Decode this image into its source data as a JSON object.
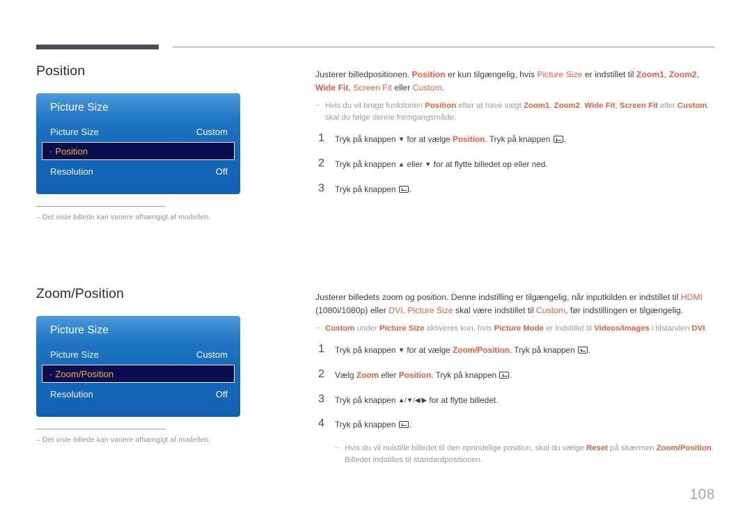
{
  "page": {
    "number": "108"
  },
  "sections": [
    {
      "id": "position",
      "title": "Position",
      "osd": {
        "title": "Picture Size",
        "rows": [
          {
            "label": "Picture Size",
            "value": "Custom",
            "selected": false
          },
          {
            "label": "Position",
            "value": "",
            "selected": true,
            "bullet": "·"
          },
          {
            "label": "Resolution",
            "value": "Off",
            "selected": false
          }
        ]
      },
      "caption": {
        "dash": "–",
        "text": "Det viste billede kan variere afhængigt af modellen."
      },
      "intro": {
        "t1": "Justerer billedpositionen. ",
        "hl1": "Position",
        "t2": " er kun tilgængelig, hvis ",
        "hl2": "Picture Size",
        "t3": " er indstillet til ",
        "hl3": "Zoom1",
        "t4": ", ",
        "hl4": "Zoom2",
        "t5": ", ",
        "hl5": "Wide Fit",
        "t6": ", ",
        "hl6": "Screen Fit",
        "t7": " eller ",
        "hl7": "Custom",
        "t8": "."
      },
      "note": {
        "dash": "–",
        "t1": "Hvis du vil bruge funktionen ",
        "hl1": "Position",
        "t2": " efter at have valgt ",
        "hl2": "Zoom1",
        "t3": ", ",
        "hl3": "Zoom2",
        "t4": ", ",
        "hl4": "Wide Fit",
        "t5": ", ",
        "hl5": "Screen Fit",
        "t6": " eller ",
        "hl6": "Custom",
        "t7": ", skal du følge denne fremgangsmåde."
      },
      "steps": [
        {
          "num": "1",
          "t1": "Tryk på knappen ",
          "arrow1": "▼",
          "t2": " for at vælge ",
          "hl1": "Position",
          "t3": ". Tryk på knappen ",
          "t4": "."
        },
        {
          "num": "2",
          "t1": "Tryk på knappen ",
          "arrow1": "▲",
          "t2": " eller ",
          "arrow2": "▼",
          "t3": " for at flytte billedet op eller ned."
        },
        {
          "num": "3",
          "t1": "Tryk på knappen ",
          "t2": "."
        }
      ]
    },
    {
      "id": "zoomposition",
      "title": "Zoom/Position",
      "osd": {
        "title": "Picture Size",
        "rows": [
          {
            "label": "Picture Size",
            "value": "Custom",
            "selected": false
          },
          {
            "label": "Zoom/Position",
            "value": "",
            "selected": true,
            "bullet": "·"
          },
          {
            "label": "Resolution",
            "value": "Off",
            "selected": false
          }
        ]
      },
      "caption": {
        "dash": "–",
        "text": "Det viste billede kan variere afhængigt af modellen."
      },
      "intro": {
        "t1": "Justerer billedets zoom og position. Denne indstilling er tilgængelig, når inputkilden er indstillet til ",
        "hl1": "HDMI",
        "t2": " (1080i/1080p) eller ",
        "hl2": "DVI",
        "t3": ". ",
        "hl3": "Picture Size",
        "t4": " skal være indstillet til ",
        "hl4": "Custom",
        "t5": ", før indstillingen er tilgængelig."
      },
      "note": {
        "dash": "–",
        "hl1": "Custom",
        "t1": " under ",
        "hl2": "Picture Size",
        "t2": " aktiveres kun, hvis ",
        "hl3": "Picture Mode",
        "t3": " er indstillet til ",
        "hl4": "Videos/Images",
        "t4": " i tilstanden ",
        "hl5": "DVI",
        "t5": "."
      },
      "steps": [
        {
          "num": "1",
          "t1": "Tryk på knappen ",
          "arrow1": "▼",
          "t2": " for at vælge ",
          "hl1": "Zoom/Position",
          "t3": ". Tryk på knappen ",
          "t4": "."
        },
        {
          "num": "2",
          "t1": "Vælg ",
          "hl1": "Zoom",
          "t2": " eller ",
          "hl2": "Position",
          "t3": ". Tryk på knappen ",
          "t4": "."
        },
        {
          "num": "3",
          "t1": "Tryk på knappen ",
          "arrows": "▲/▼/◀/▶",
          "t2": " for at flytte billedet."
        },
        {
          "num": "4",
          "t1": "Tryk på knappen ",
          "t2": "."
        }
      ],
      "step_note": {
        "dash": "–",
        "t1": "Hvis du vil nulstille billedet til den oprindelige position, skal du vælge ",
        "hl1": "Reset",
        "t2": " på skærmen ",
        "hl2": "Zoom/Position",
        "t3": ". Billedet indstilles til standardpositionen."
      }
    }
  ],
  "colors": {
    "accent_orange": "#ed5b3f",
    "osd_blue_top": "#4f9ad8",
    "osd_blue_bottom": "#1361b4",
    "osd_selected_bg": "#0c0c52",
    "osd_selected_text": "#f0b43c",
    "rule_dark": "#4b4b5a"
  }
}
